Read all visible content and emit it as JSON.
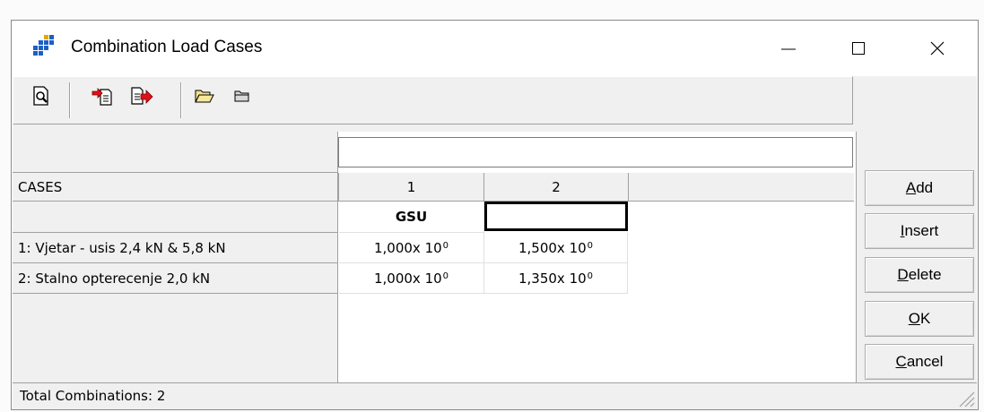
{
  "window": {
    "title": "Combination Load Cases",
    "controls": [
      "minimize",
      "maximize",
      "close"
    ]
  },
  "toolbar": {
    "buttons": [
      {
        "icon": "print-preview-icon"
      },
      {
        "icon": "import-icon"
      },
      {
        "icon": "export-icon"
      },
      {
        "icon": "open-folder-icon"
      },
      {
        "icon": "folder-icon"
      }
    ]
  },
  "grid": {
    "edit_value": "",
    "header_label": "CASES",
    "columns": [
      "1",
      "2"
    ],
    "combination_names": [
      "GSU",
      ""
    ],
    "rows": [
      {
        "label": "1: Vjetar - usis 2,4 kN & 5,8 kN",
        "values": [
          {
            "mantissa": "1,000",
            "base": "x 10",
            "exp": "0"
          },
          {
            "mantissa": "1,500",
            "base": "x 10",
            "exp": "0"
          }
        ]
      },
      {
        "label": "2: Stalno opterecenje 2,0 kN",
        "values": [
          {
            "mantissa": "1,000",
            "base": "x 10",
            "exp": "0"
          },
          {
            "mantissa": "1,350",
            "base": "x 10",
            "exp": "0"
          }
        ]
      }
    ]
  },
  "buttons": {
    "add": {
      "pre": "",
      "ul": "A",
      "post": "dd"
    },
    "insert": {
      "pre": "",
      "ul": "I",
      "post": "nsert"
    },
    "delete": {
      "pre": "",
      "ul": "D",
      "post": "elete"
    },
    "ok": {
      "pre": "",
      "ul": "O",
      "post": "K"
    },
    "cancel": {
      "pre": "",
      "ul": "C",
      "post": "ancel"
    }
  },
  "status": {
    "text": "Total Combinations: 2"
  }
}
